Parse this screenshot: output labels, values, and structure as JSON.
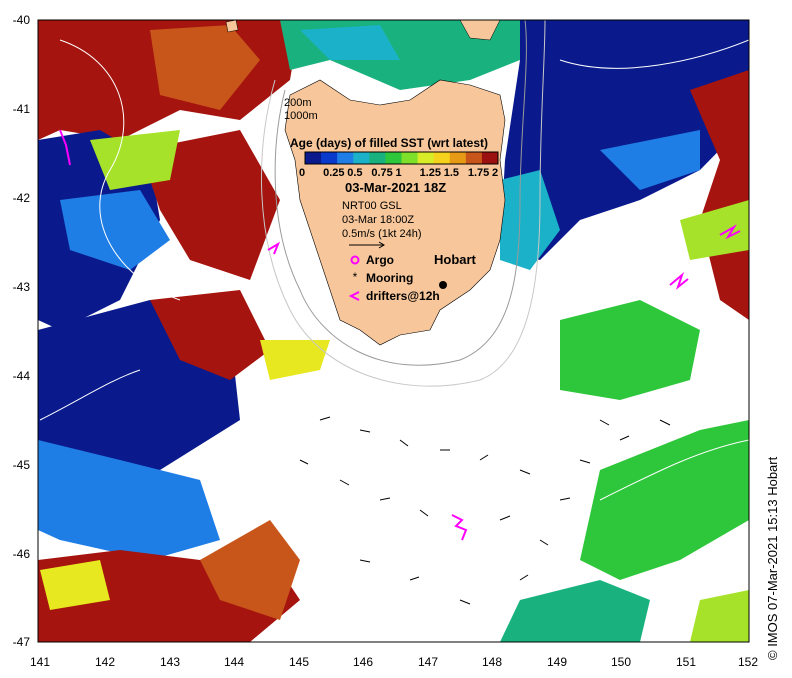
{
  "map": {
    "x_ticks": [
      "141",
      "142",
      "143",
      "144",
      "145",
      "146",
      "147",
      "148",
      "149",
      "150",
      "151",
      "152"
    ],
    "y_ticks": [
      "-40",
      "-41",
      "-42",
      "-43",
      "-44",
      "-45",
      "-46",
      "-47"
    ],
    "lon_range": [
      141,
      152
    ],
    "lat_range": [
      -47,
      -40
    ]
  },
  "contours": {
    "line1": "200m",
    "line2": "1000m"
  },
  "colorbar": {
    "title": "Age (days) of filled SST (wrt latest)",
    "tick_labels": [
      "0",
      "0.25",
      "0.5",
      "0.75",
      "1",
      "1.25",
      "1.5",
      "1.75",
      "2"
    ],
    "date": "03-Mar-2021 18Z",
    "colors": [
      "#0a1a8c",
      "#0a3acb",
      "#1f7ee6",
      "#1bb2c9",
      "#19b27e",
      "#2ec63b",
      "#7ee02a",
      "#d8ec28",
      "#f5d21c",
      "#e79a16",
      "#c8561a",
      "#9b1010"
    ]
  },
  "currents": {
    "line1": "NRT00 GSL",
    "line2": "03-Mar 18:00Z",
    "line3": "0.5m/s (1kt 24h)"
  },
  "legend": {
    "argo": "Argo",
    "mooring": "Mooring",
    "drifters": "drifters@12h"
  },
  "places": {
    "hobart": "Hobart"
  },
  "credit": "© IMOS 07-Mar-2021 15:13 Hobart",
  "colors": {
    "land": "#f7c79b",
    "argo": "#ff00ff",
    "drifter": "#ff00ff"
  }
}
